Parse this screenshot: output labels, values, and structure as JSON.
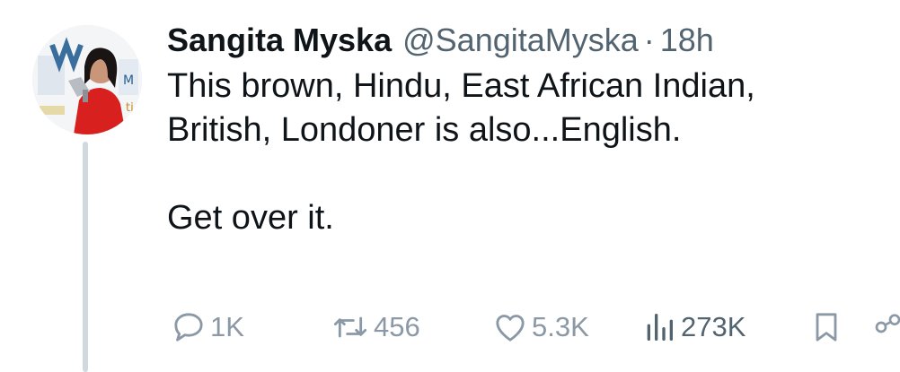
{
  "tweet": {
    "display_name": "Sangita Myska",
    "handle": "@SangitaMyska",
    "separator": "·",
    "time": "18h",
    "text_lines": [
      "This brown, Hindu, East African Indian,",
      "British, Londoner is also...English.",
      "",
      "Get over it."
    ]
  },
  "actions": {
    "replies": "1K",
    "retweets": "456",
    "likes": "5.3K",
    "views": "273K"
  },
  "icons": {
    "reply": "speech-bubble-icon",
    "retweet": "retweet-arrows-icon",
    "like": "heart-icon",
    "views": "bar-chart-icon",
    "bookmark": "bookmark-icon",
    "share": "share-icon"
  },
  "colors": {
    "text": "#0f1419",
    "secondary": "#536471",
    "muted_icon": "#8b98a5",
    "thread_line": "#cfd9de"
  }
}
